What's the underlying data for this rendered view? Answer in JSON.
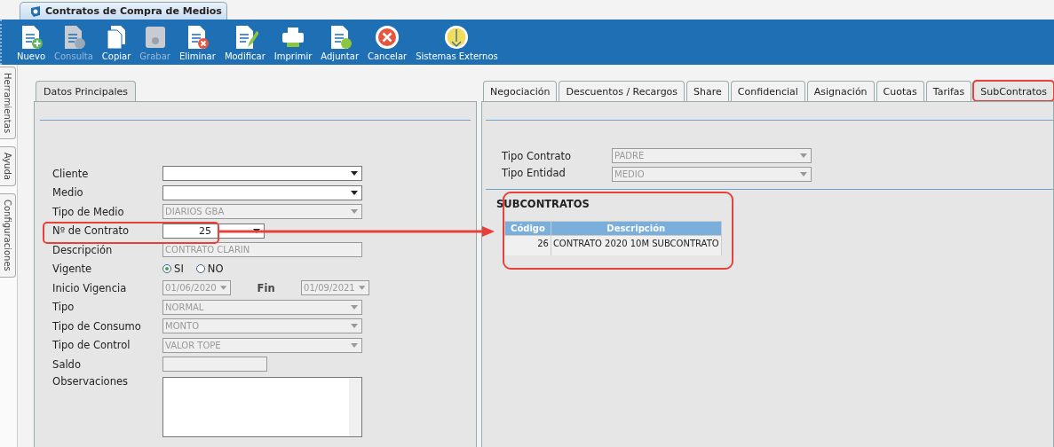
{
  "window": {
    "title": "Contratos de Compra de Medios"
  },
  "toolbar": [
    {
      "label": "Nuevo",
      "kind": "new",
      "disabled": false
    },
    {
      "label": "Consulta",
      "kind": "query",
      "disabled": true
    },
    {
      "label": "Copiar",
      "kind": "copy",
      "disabled": false
    },
    {
      "label": "Grabar",
      "kind": "save",
      "disabled": true
    },
    {
      "label": "Eliminar",
      "kind": "delete",
      "disabled": false
    },
    {
      "label": "Modificar",
      "kind": "edit",
      "disabled": false
    },
    {
      "label": "Imprimir",
      "kind": "print",
      "disabled": false
    },
    {
      "label": "Adjuntar",
      "kind": "attach",
      "disabled": false
    },
    {
      "label": "Cancelar",
      "kind": "cancel",
      "disabled": false
    },
    {
      "label": "Sistemas Externos",
      "kind": "external",
      "disabled": false
    }
  ],
  "side_tabs": [
    "Herramientas",
    "Ayuda",
    "Configuraciones"
  ],
  "left_panel": {
    "tab": "Datos Principales",
    "fields": [
      {
        "kind": "combo",
        "label": "Cliente",
        "disabled": false
      },
      {
        "kind": "combo",
        "label": "Medio",
        "disabled": false
      },
      {
        "kind": "combo",
        "label": "Tipo de Medio",
        "value": "DIARIOS GBA",
        "disabled": true
      },
      {
        "kind": "number",
        "label": "Nº de Contrato",
        "value": "25",
        "disabled": false
      },
      {
        "kind": "text",
        "label": "Descripción",
        "value": "CONTRATO CLARIN",
        "disabled": true
      },
      {
        "kind": "radio",
        "label": "Vigente",
        "options": [
          {
            "label": "SI",
            "selected": true
          },
          {
            "label": "NO",
            "selected": false
          }
        ]
      },
      {
        "kind": "date",
        "label": "Inicio Vigencia",
        "value": "01/06/2020",
        "end_label": "Fin",
        "end_value": "01/09/2021",
        "disabled": true
      },
      {
        "kind": "combo",
        "label": "Tipo",
        "value": "NORMAL",
        "disabled": true
      },
      {
        "kind": "combo",
        "label": "Tipo de Consumo",
        "value": "MONTO",
        "disabled": true
      },
      {
        "kind": "combo",
        "label": "Tipo de Control",
        "value": "VALOR TOPE",
        "disabled": true
      },
      {
        "kind": "amount",
        "label": "Saldo",
        "disabled": true
      },
      {
        "kind": "textarea",
        "label": "Observaciones",
        "disabled": false
      }
    ]
  },
  "right_panel": {
    "tabs": [
      {
        "label": "Negociación",
        "selected": false
      },
      {
        "label": "Descuentos / Recargos",
        "selected": false
      },
      {
        "label": "Share",
        "selected": false
      },
      {
        "label": "Confidencial",
        "selected": false
      },
      {
        "label": "Asignación",
        "selected": false
      },
      {
        "label": "Cuotas",
        "selected": false
      },
      {
        "label": "Tarifas",
        "selected": false
      },
      {
        "label": "SubContratos",
        "selected": true
      }
    ],
    "fields": [
      {
        "kind": "combo",
        "label": "Tipo Contrato",
        "value": "PADRE",
        "disabled": true
      },
      {
        "kind": "combo",
        "label": "Tipo Entidad",
        "value": "MEDIO",
        "disabled": true
      }
    ],
    "section_title": "SUBCONTRATOS",
    "table": {
      "columns": [
        "Código",
        "Descripción"
      ],
      "rows": [
        [
          "26",
          "CONTRATO 2020 10M  SUBCONTRATO"
        ]
      ]
    }
  }
}
